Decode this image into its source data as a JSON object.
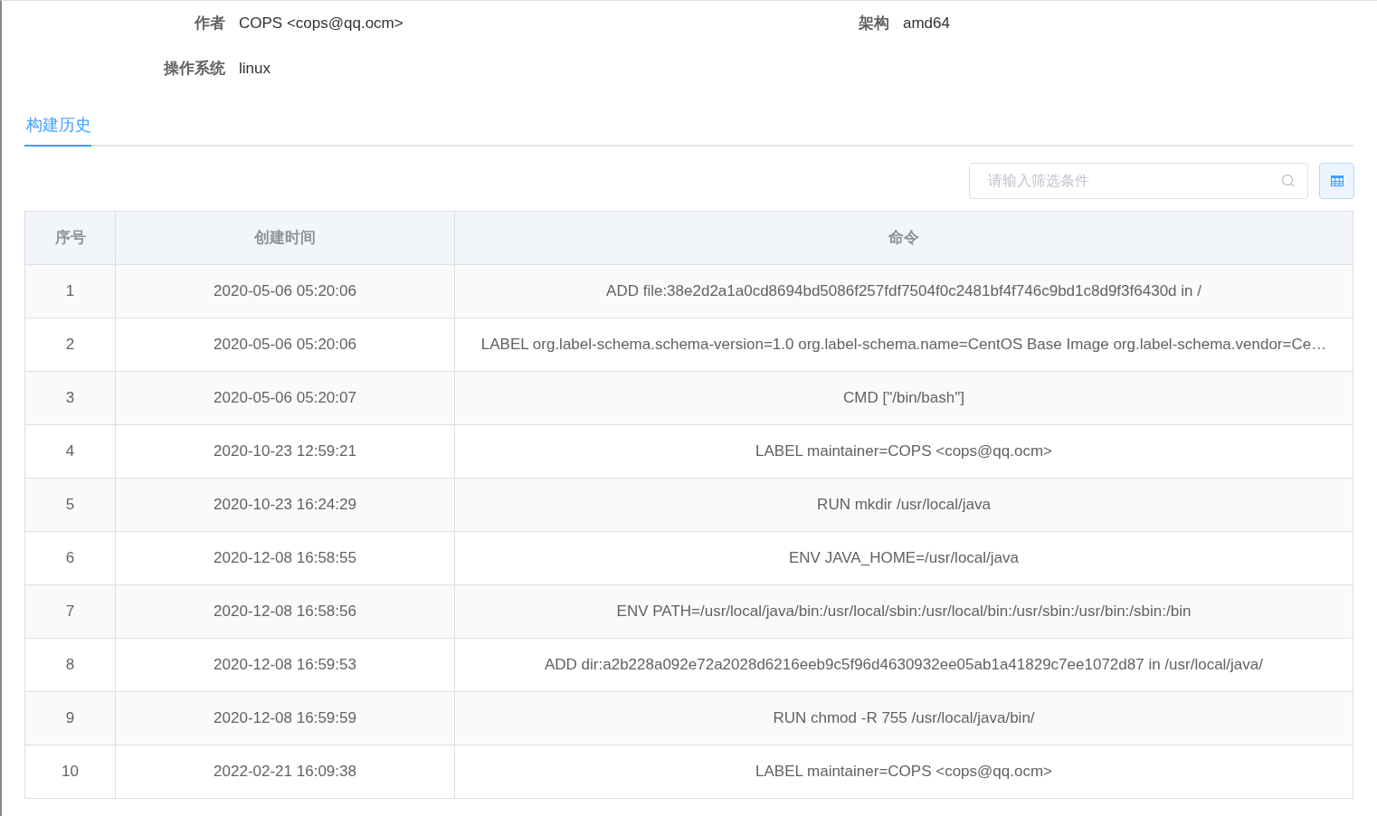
{
  "info": [
    {
      "label": "作者",
      "value": "COPS <cops@qq.ocm>"
    },
    {
      "label": "架构",
      "value": "amd64"
    },
    {
      "label": "操作系统",
      "value": "linux"
    }
  ],
  "tabs": [
    {
      "label": "构建历史",
      "selected": true
    }
  ],
  "search": {
    "placeholder": "请输入筛选条件"
  },
  "table": {
    "columns": [
      "序号",
      "创建时间",
      "命令"
    ],
    "rows": [
      [
        "1",
        "2020-05-06 05:20:06",
        "ADD file:38e2d2a1a0cd8694bd5086f257fdf7504f0c2481bf4f746c9bd1c8d9f3f6430d in /"
      ],
      [
        "2",
        "2020-05-06 05:20:06",
        "LABEL org.label-schema.schema-version=1.0 org.label-schema.name=CentOS Base Image org.label-schema.vendor=Ce…"
      ],
      [
        "3",
        "2020-05-06 05:20:07",
        "CMD [\"/bin/bash\"]"
      ],
      [
        "4",
        "2020-10-23 12:59:21",
        "LABEL maintainer=COPS <cops@qq.ocm>"
      ],
      [
        "5",
        "2020-10-23 16:24:29",
        "RUN mkdir /usr/local/java"
      ],
      [
        "6",
        "2020-12-08 16:58:55",
        "ENV JAVA_HOME=/usr/local/java"
      ],
      [
        "7",
        "2020-12-08 16:58:56",
        "ENV PATH=/usr/local/java/bin:/usr/local/sbin:/usr/local/bin:/usr/sbin:/usr/bin:/sbin:/bin"
      ],
      [
        "8",
        "2020-12-08 16:59:53",
        "ADD dir:a2b228a092e72a2028d6216eeb9c5f96d4630932ee05ab1a41829c7ee1072d87 in /usr/local/java/"
      ],
      [
        "9",
        "2020-12-08 16:59:59",
        "RUN chmod -R 755 /usr/local/java/bin/"
      ],
      [
        "10",
        "2022-02-21 16:09:38",
        "LABEL maintainer=COPS <cops@qq.ocm>"
      ]
    ]
  }
}
